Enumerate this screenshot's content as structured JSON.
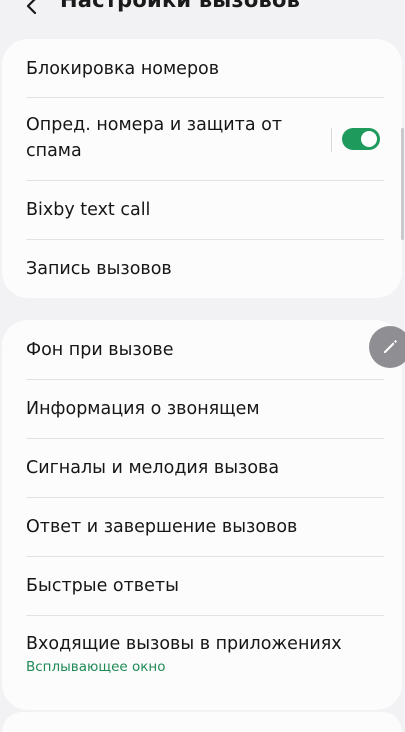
{
  "header": {
    "title": "Настройки вызовов"
  },
  "group1": {
    "items": [
      {
        "label": "Блокировка номеров"
      },
      {
        "label_line1": "Опред. номера и защита от",
        "label_line2": "спама",
        "toggle_on": true
      },
      {
        "label": "Bixby text call"
      },
      {
        "label": "Запись вызовов"
      }
    ]
  },
  "group2": {
    "items": [
      {
        "label": "Фон при вызове"
      },
      {
        "label": "Информация о звонящем"
      },
      {
        "label": "Сигналы и мелодия вызова"
      },
      {
        "label": "Ответ и завершение вызовов"
      },
      {
        "label": "Быстрые ответы"
      },
      {
        "label": "Входящие вызовы в приложениях",
        "sub": "Всплывающее окно"
      }
    ]
  },
  "colors": {
    "accent": "#1e9a5c",
    "background": "#f2f2f4",
    "card": "#fcfcfc"
  },
  "icons": {
    "back": "chevron-left-icon",
    "edit": "pencil-icon"
  }
}
